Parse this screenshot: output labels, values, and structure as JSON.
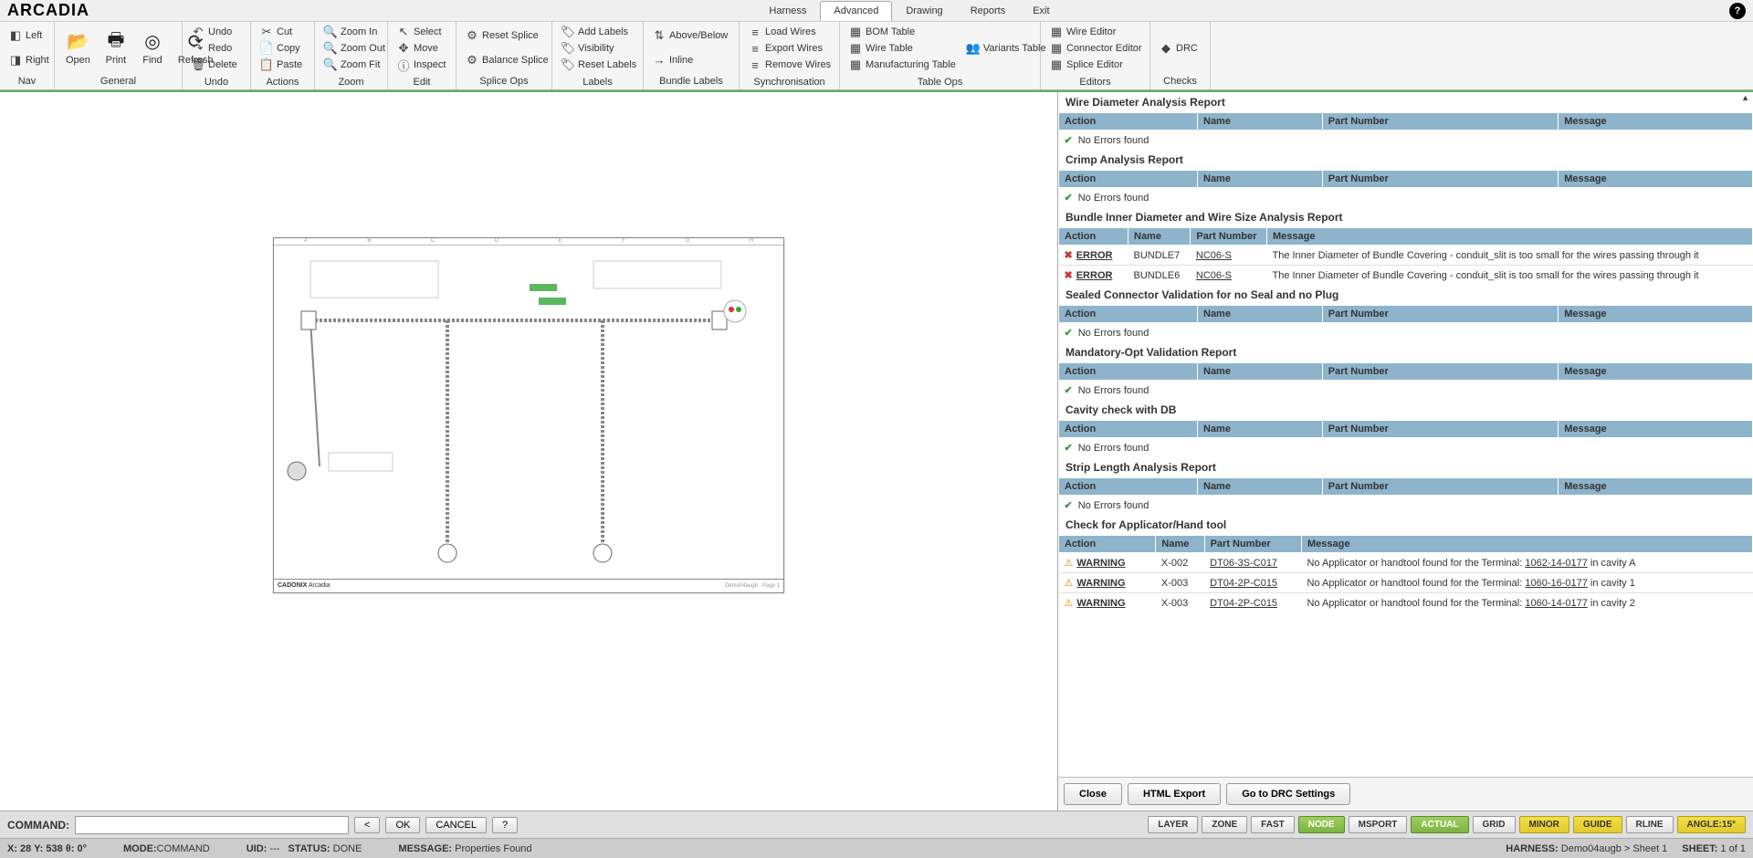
{
  "app": {
    "name": "ARCADIA"
  },
  "menu": {
    "tabs": [
      "Harness",
      "Advanced",
      "Drawing",
      "Reports",
      "Exit"
    ],
    "active": "Advanced"
  },
  "ribbon": {
    "nav": {
      "label": "Nav",
      "left": "Left",
      "right": "Right"
    },
    "general": {
      "label": "General",
      "open": "Open",
      "print": "Print",
      "find": "Find",
      "refresh": "Refresh"
    },
    "undo": {
      "label": "Undo",
      "undo": "Undo",
      "redo": "Redo",
      "delete": "Delete"
    },
    "actions": {
      "label": "Actions",
      "cut": "Cut",
      "copy": "Copy",
      "paste": "Paste"
    },
    "zoom": {
      "label": "Zoom",
      "in": "Zoom In",
      "out": "Zoom Out",
      "fit": "Zoom Fit"
    },
    "edit": {
      "label": "Edit",
      "select": "Select",
      "move": "Move",
      "inspect": "Inspect"
    },
    "splice": {
      "label": "Splice Ops",
      "reset": "Reset Splice",
      "balance": "Balance Splice"
    },
    "labels": {
      "label": "Labels",
      "add": "Add Labels",
      "visibility": "Visibility",
      "reset": "Reset Labels"
    },
    "bundle": {
      "label": "Bundle Labels",
      "ab": "Above/Below",
      "inline": "Inline"
    },
    "sync": {
      "label": "Synchronisation",
      "load": "Load Wires",
      "export": "Export Wires",
      "remove": "Remove Wires"
    },
    "table": {
      "label": "Table Ops",
      "bom": "BOM Table",
      "wire": "Wire Table",
      "mfg": "Manufacturing Table",
      "variants": "Variants Table"
    },
    "editors": {
      "label": "Editors",
      "wire": "Wire Editor",
      "connector": "Connector Editor",
      "splice": "Splice Editor"
    },
    "checks": {
      "label": "Checks",
      "drc": "DRC"
    }
  },
  "sheet": {
    "brand": "CADONIX",
    "ref": "Arcadia"
  },
  "drc": {
    "sections": [
      {
        "title": "Wire Diameter Analysis Report",
        "cols4": true,
        "no_errors": "No Errors found"
      },
      {
        "title": "Crimp Analysis Report",
        "cols4": true,
        "no_errors": "No Errors found"
      },
      {
        "title": "Bundle Inner Diameter and Wire Size Analysis Report",
        "cols4b": true,
        "rows": [
          {
            "lvl": "ERROR",
            "name": "BUNDLE7",
            "pn": "NC06-S",
            "msg": "The Inner Diameter of Bundle Covering - conduit_slit is too small for the wires passing through it"
          },
          {
            "lvl": "ERROR",
            "name": "BUNDLE6",
            "pn": "NC06-S",
            "msg": "The Inner Diameter of Bundle Covering - conduit_slit is too small for the wires passing through it"
          }
        ]
      },
      {
        "title": "Sealed Connector Validation for no Seal and no Plug",
        "cols4": true,
        "no_errors": "No Errors found"
      },
      {
        "title": "Mandatory-Opt Validation Report",
        "cols4": true,
        "no_errors": "No Errors found"
      },
      {
        "title": "Cavity check with DB",
        "cols4": true,
        "no_errors": "No Errors found"
      },
      {
        "title": "Strip Length Analysis Report",
        "cols4": true,
        "no_errors": "No Errors found"
      },
      {
        "title": "Check for Applicator/Hand tool",
        "cols4c": true,
        "rows": [
          {
            "lvl": "WARNING",
            "name": "X-002",
            "pn": "DT06-3S-C017",
            "msg_pre": "No Applicator or handtool found for the Terminal: ",
            "msg_link": "1062-14-0177",
            "msg_post": " in cavity A"
          },
          {
            "lvl": "WARNING",
            "name": "X-003",
            "pn": "DT04-2P-C015",
            "msg_pre": "No Applicator or handtool found for the Terminal: ",
            "msg_link": "1060-16-0177",
            "msg_post": " in cavity 1"
          },
          {
            "lvl": "WARNING",
            "name": "X-003",
            "pn": "DT04-2P-C015",
            "msg_pre": "No Applicator or handtool found for the Terminal: ",
            "msg_link": "1060-14-0177",
            "msg_post": " in cavity 2"
          }
        ]
      }
    ],
    "headers": {
      "action": "Action",
      "name": "Name",
      "pn": "Part Number",
      "msg": "Message"
    },
    "buttons": {
      "close": "Close",
      "html": "HTML Export",
      "goto": "Go to DRC Settings"
    }
  },
  "cmd": {
    "label": "COMMAND:",
    "prev": "<",
    "ok": "OK",
    "cancel": "CANCEL",
    "help": "?"
  },
  "toggles": [
    "LAYER",
    "ZONE",
    "FAST",
    "NODE",
    "MSPORT",
    "ACTUAL",
    "GRID",
    "MINOR",
    "GUIDE",
    "RLINE",
    "ANGLE:15°"
  ],
  "toggle_state": {
    "NODE": "green",
    "ACTUAL": "green",
    "MINOR": "yellow",
    "GUIDE": "yellow",
    "ANGLE:15°": "yellow"
  },
  "status": {
    "coords_label": "X: 28 Y: 538 θ: 0°",
    "mode_label": "MODE:",
    "mode_val": "COMMAND",
    "uid_label": "UID:",
    "uid_val": " ---",
    "status_label": "STATUS:",
    "status_val": " DONE",
    "msg_label": "MESSAGE:",
    "msg_val": " Properties Found",
    "harness_label": "HARNESS:",
    "harness_val": " Demo04augb > Sheet 1",
    "sheet_label": "SHEET:",
    "sheet_val": " 1 of 1"
  }
}
